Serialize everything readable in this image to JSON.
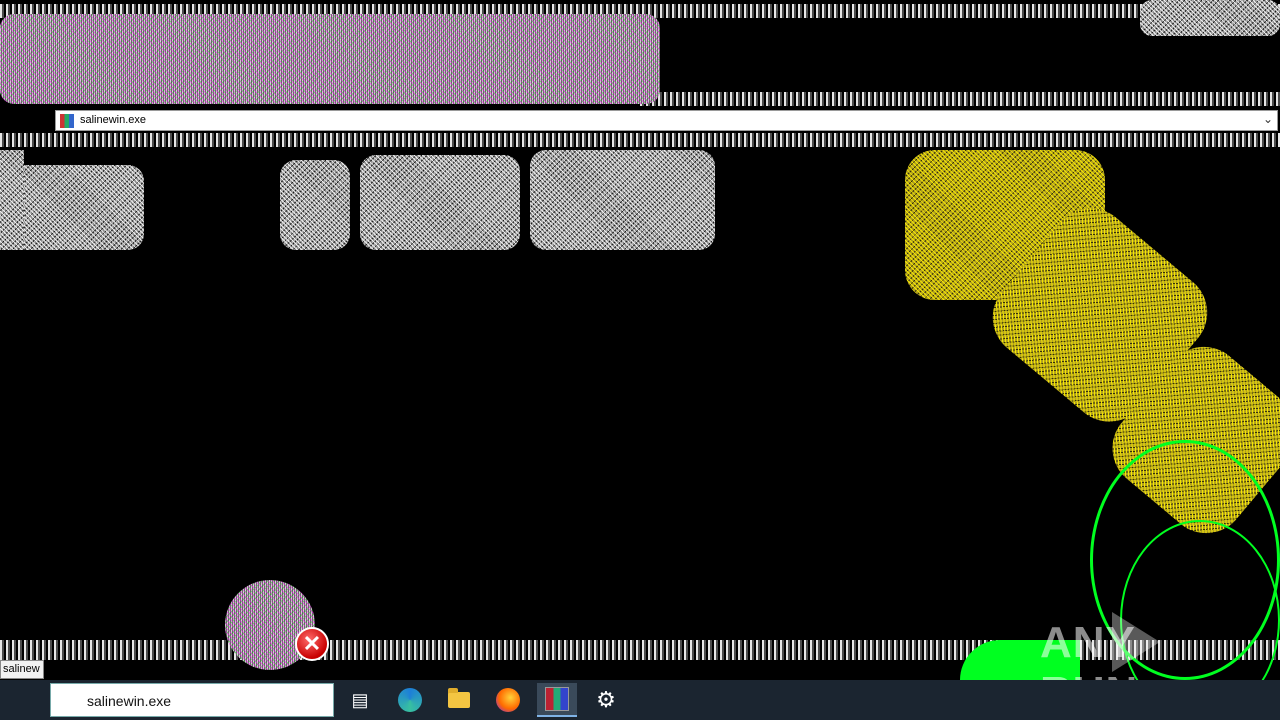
{
  "window": {
    "title": "salinewin.exe",
    "icon": "winrar-icon"
  },
  "tooltip": {
    "text": "salinew"
  },
  "taskbar": {
    "search_value": "salinewin.exe",
    "items": [
      {
        "name": "task-view",
        "icon": "task-view-icon"
      },
      {
        "name": "edge",
        "icon": "edge-icon"
      },
      {
        "name": "file-explorer",
        "icon": "folder-icon"
      },
      {
        "name": "firefox",
        "icon": "firefox-icon"
      },
      {
        "name": "winrar",
        "icon": "winrar-icon",
        "active": true
      },
      {
        "name": "settings",
        "icon": "gear-icon"
      }
    ]
  },
  "error_dialog_icon": "error-icon",
  "watermark": {
    "text_left": "ANY",
    "text_right": "RUN"
  },
  "colors": {
    "taskbar": "#1b2530",
    "glitch_green": "#00ff20",
    "glitch_yellow": "#d8c820"
  }
}
